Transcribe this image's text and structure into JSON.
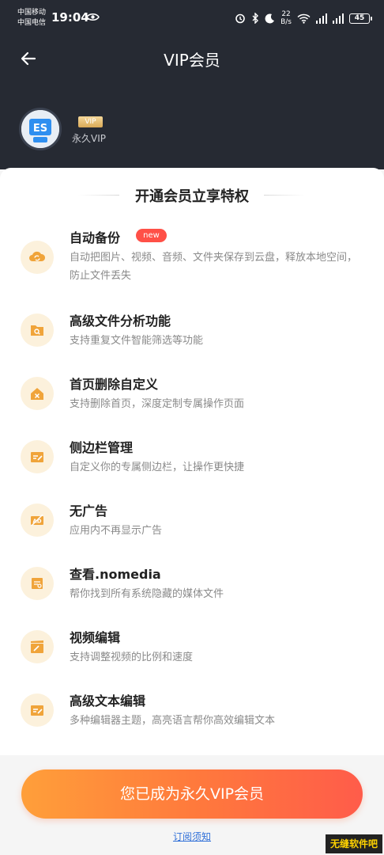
{
  "status_bar": {
    "carrier_1": "中国移动",
    "carrier_2": "中国电信",
    "time": "19:04",
    "speed_value": "22",
    "speed_unit": "B/s",
    "battery": "45"
  },
  "header": {
    "title": "VIP会员",
    "vip_badge": "VIP",
    "membership": "永久VIP"
  },
  "section": {
    "title": "开通会员立享特权"
  },
  "features": [
    {
      "title": "自动备份",
      "badge": "new",
      "desc": "自动把图片、视频、音频、文件夹保存到云盘，释放本地空间，防止文件丢失",
      "icon": "cloud-sync-icon"
    },
    {
      "title": "高级文件分析功能",
      "desc": "支持重复文件智能筛选等功能",
      "icon": "file-search-icon"
    },
    {
      "title": "首页删除自定义",
      "desc": "支持删除首页，深度定制专属操作页面",
      "icon": "home-delete-icon"
    },
    {
      "title": "侧边栏管理",
      "desc": "自定义你的专属侧边栏，让操作更快捷",
      "icon": "edit-list-icon"
    },
    {
      "title": "无广告",
      "desc": "应用内不再显示广告",
      "icon": "no-ad-icon"
    },
    {
      "title": "查看.nomedia",
      "desc": "帮你找到所有系统隐藏的媒体文件",
      "icon": "hidden-file-icon"
    },
    {
      "title": "视频编辑",
      "desc": "支持调整视频的比例和速度",
      "icon": "video-edit-icon"
    },
    {
      "title": "高级文本编辑",
      "desc": "多种编辑器主题，高亮语言帮你高效编辑文本",
      "icon": "text-edit-icon"
    }
  ],
  "footer": {
    "cta": "您已成为永久VIP会员",
    "notice": "订阅须知",
    "watermark": "无缝软件吧"
  },
  "colors": {
    "header_bg": "#262a33",
    "icon_bg": "#fcf1dc",
    "icon_fg": "#f0a43a",
    "cta_start": "#ff9f3a",
    "cta_end": "#ff5c4a",
    "new_badge": "#ff5047"
  }
}
